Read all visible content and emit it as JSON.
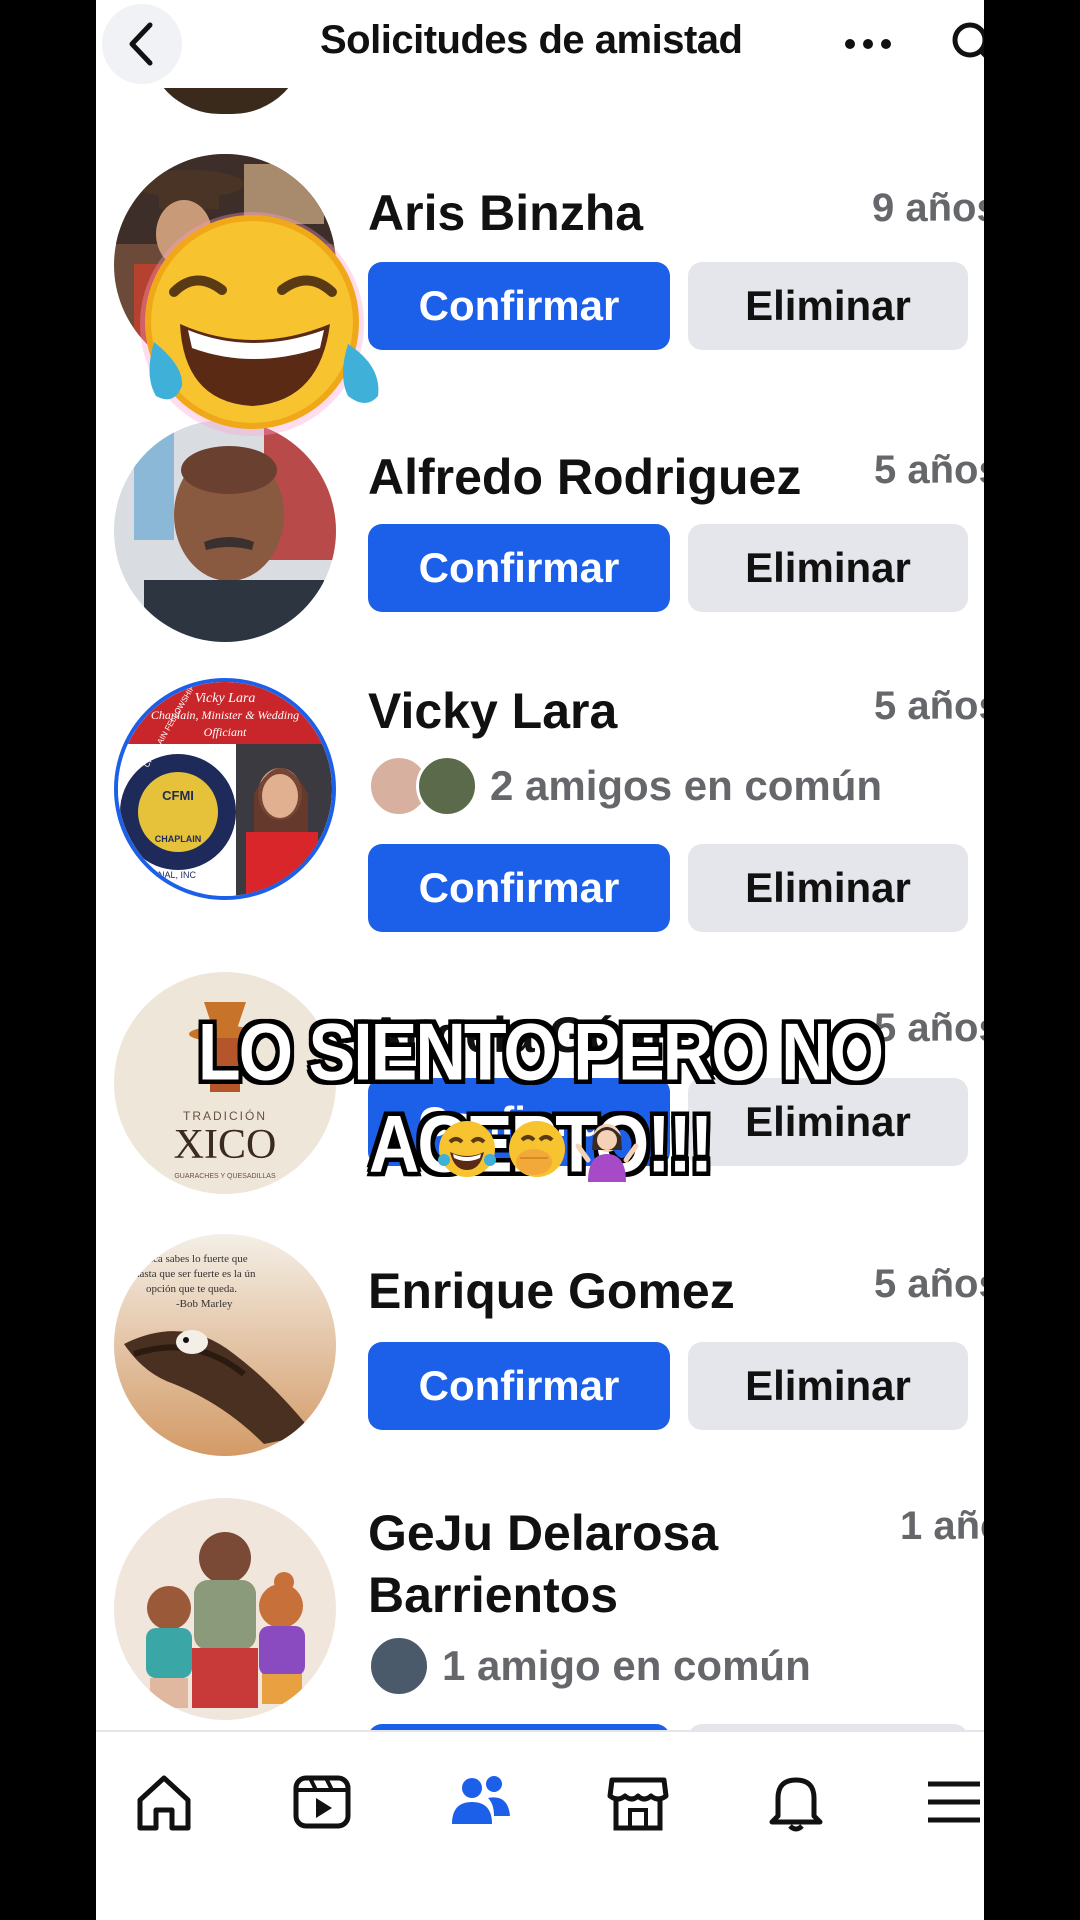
{
  "header": {
    "title": "Solicitudes de amistad",
    "back_icon": "chevron-left-icon",
    "more_icon": "more-horizontal-icon",
    "search_icon": "search-icon"
  },
  "requests": [
    {
      "name": "Aris Binzha",
      "time": "9 años",
      "confirm": "Confirmar",
      "delete": "Eliminar"
    },
    {
      "name": "Alfredo Rodriguez",
      "time": "5 años",
      "confirm": "Confirmar",
      "delete": "Eliminar"
    },
    {
      "name": "Vicky Lara",
      "time": "5 años",
      "mutual": "2 amigos en común",
      "confirm": "Confirmar",
      "delete": "Eliminar",
      "avatar_text": {
        "line1": "Vicky Lara",
        "line2": "Chaplain, Minister & Wedding",
        "line3": "Officiant",
        "badge": "CFMI",
        "badge2": "CHAPLAIN",
        "ring": "CHAPLAIN FELLOWSHIP MINISTRIES",
        "ring2": "NAL, INC"
      }
    },
    {
      "name": "Angela Gómez",
      "time": "5 años",
      "confirm": "Confirmar",
      "delete": "Eliminar",
      "avatar_text": {
        "line1": "TRADICIÓN",
        "line2": "XICO",
        "line3": "GUARACHES Y QUESADILLAS"
      }
    },
    {
      "name": "Enrique Gomez",
      "time": "5 años",
      "confirm": "Confirmar",
      "delete": "Eliminar",
      "avatar_text": {
        "line1": "Nunca sabes lo fuerte que",
        "line2": "hasta que ser fuerte es la ún",
        "line3": "opción que te queda.",
        "line4": "-Bob Marley"
      }
    },
    {
      "name": "GeJu Delarosa Barrientos",
      "time": "1 año",
      "mutual": "1 amigo en común"
    }
  ],
  "overlay": {
    "caption": "LO SIENTO PERO NO ACEPTO!!!",
    "emojis": [
      "tears-of-joy-emoji",
      "hand-over-mouth-emoji",
      "shrug-emoji"
    ],
    "big_emoji": "rolling-laughing-emoji"
  },
  "nav": [
    {
      "name": "home-icon",
      "active": false
    },
    {
      "name": "video-icon",
      "active": false
    },
    {
      "name": "friends-icon",
      "active": true
    },
    {
      "name": "marketplace-icon",
      "active": false
    },
    {
      "name": "bell-icon",
      "active": false
    },
    {
      "name": "menu-icon",
      "active": false
    }
  ],
  "colors": {
    "accent": "#1c5fe8",
    "button_grey": "#e4e6eb",
    "text_secondary": "#65676b"
  }
}
